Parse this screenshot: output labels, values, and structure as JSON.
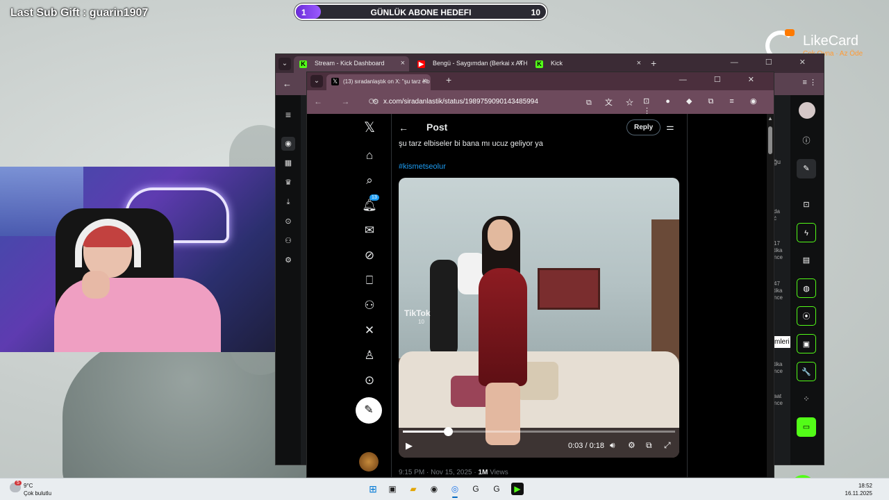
{
  "overlay": {
    "last_sub_gift": "Last Sub Gift : guarin1907",
    "goal": {
      "current": "1",
      "title": "GÜNLÜK ABONE HEDEFI",
      "target": "10",
      "progress_fraction": 0.1
    },
    "brand": {
      "name": "LikeCard",
      "tagline": "Çok Oyna · Az Öde"
    }
  },
  "kick_window": {
    "tabs": [
      {
        "label": "Stream - Kick Dashboard",
        "favicon": "kick-icon"
      },
      {
        "label": "Bengü - Saygımdan (Berkai x ATHC",
        "favicon": "youtube-icon"
      },
      {
        "label": "Kick",
        "favicon": "kick-icon"
      }
    ],
    "new_tab": "+",
    "tab_close": "×",
    "nav_back": "←",
    "nav_forward": "→",
    "toolbar_icons": "≡ ⋮",
    "window_controls": "— ☐ ✕",
    "chat_strip": [
      "ğu",
      "da",
      "ć",
      "17",
      "tika",
      "nce",
      "47",
      "tika",
      "nce",
      "ön",
      "tika",
      "nce",
      "aat",
      "nce"
    ],
    "tooltip": "mleri"
  },
  "x_window": {
    "tab_title": "(13) sıradanlaştık on X: \"şu tarz elb",
    "url": "x.com/siradanlastik/status/1989759090143485994",
    "window_controls": "— ☐ ✕",
    "new_tab": "+",
    "nav_icons": "← → ⟳",
    "omni_icons": "⧉ 文 ☆",
    "ext_icons": "⊡ ● ◆ ⧉ ≡ ◉ ⋮",
    "notification_count": "13",
    "post": {
      "header_title": "Post",
      "reply_label": "Reply",
      "text": "şu tarz elbiseler bi bana mı ucuz geliyor ya",
      "hashtag": "#kismetseolur",
      "timestamp": "9:15 PM · Nov 15, 2025 · ",
      "views_count": "1M",
      "views_label": " Views"
    },
    "video": {
      "watermark": "TikTok",
      "watermark_user": "10",
      "time": "0:03 / 0:18",
      "progress_fraction": 0.167
    }
  },
  "taskbar": {
    "weather_badge": "5",
    "temperature": "9°C",
    "condition": "Çok bulutlu",
    "time": "18:52",
    "date": "16.11.2025"
  },
  "colors": {
    "kick_green": "#53fc18",
    "x_blue": "#1d9bf0",
    "goal_purple": "#7b3cf0",
    "brand_orange": "#ff7a00"
  }
}
